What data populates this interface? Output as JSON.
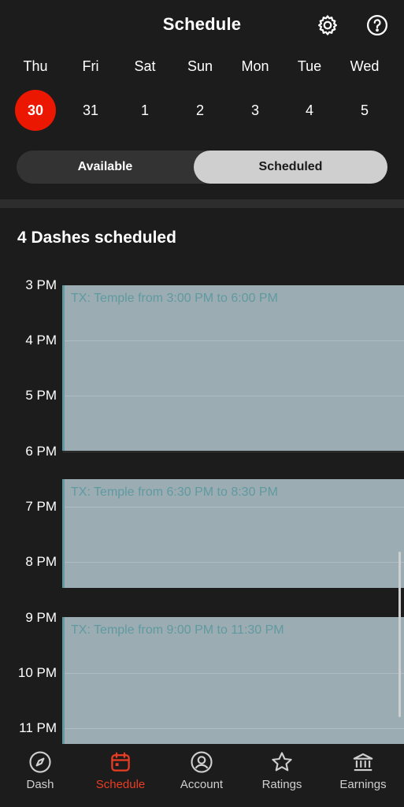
{
  "header": {
    "title": "Schedule",
    "settings_icon": "gear-icon",
    "help_icon": "help-circle-icon"
  },
  "week": {
    "days": [
      "Thu",
      "Fri",
      "Sat",
      "Sun",
      "Mon",
      "Tue",
      "Wed"
    ],
    "dates": [
      "30",
      "31",
      "1",
      "2",
      "3",
      "4",
      "5"
    ],
    "selected_index": 0,
    "selected_color": "#eb1700"
  },
  "toggle": {
    "available_label": "Available",
    "scheduled_label": "Scheduled",
    "active": "Scheduled"
  },
  "summary": {
    "count_label": "4 Dashes scheduled"
  },
  "timeline": {
    "hours": [
      "3 PM",
      "4 PM",
      "5 PM",
      "6 PM",
      "7 PM",
      "8 PM",
      "9 PM",
      "10 PM",
      "11 PM"
    ],
    "blocks": [
      {
        "label": "TX: Temple from 3:00 PM to 6:00 PM"
      },
      {
        "label": "TX: Temple from 6:30 PM to 8:30 PM"
      },
      {
        "label": "TX: Temple from 9:00 PM to 11:30 PM"
      }
    ],
    "block_color": "#9cacb3",
    "block_text_color": "#5f9aa0"
  },
  "tabbar": {
    "tabs": [
      {
        "label": "Dash",
        "icon": "compass-icon"
      },
      {
        "label": "Schedule",
        "icon": "calendar-icon"
      },
      {
        "label": "Account",
        "icon": "account-icon"
      },
      {
        "label": "Ratings",
        "icon": "star-icon"
      },
      {
        "label": "Earnings",
        "icon": "bank-icon"
      }
    ],
    "active": "Schedule",
    "active_color": "#eb3d24"
  }
}
